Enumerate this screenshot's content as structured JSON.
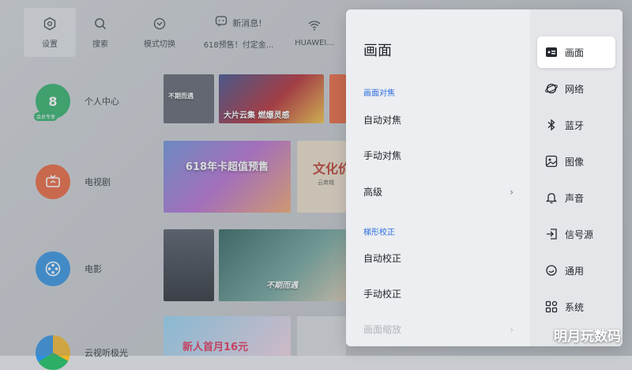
{
  "topbar": {
    "settings": "设置",
    "search": "搜索",
    "mode_switch": "模式切换",
    "message_title": "新消息!",
    "message_text": "618预售！付定金...",
    "wifi": "HUAWEI..."
  },
  "categories": {
    "personal": "个人中心",
    "personal_badge": "会员专享",
    "tv": "电视剧",
    "movie": "电影",
    "video": "云视听极光"
  },
  "tiles": {
    "t1_caption": "大片云集 燃爆灵感",
    "t1_small": "不期而遇",
    "t2_caption": "618年卡超值预售",
    "t3_caption": "文化价",
    "t3_small": "云商城",
    "t4_caption": "不期而遇",
    "t5_caption": "新人首月16元"
  },
  "panel": {
    "title": "画面",
    "section_focus": "画面对焦",
    "auto_focus": "自动对焦",
    "manual_focus": "手动对焦",
    "advanced": "高级",
    "section_keystone": "梯形校正",
    "auto_correct": "自动校正",
    "manual_correct": "手动校正",
    "picture_zoom": "画面缩放"
  },
  "nav": {
    "picture": "画面",
    "network": "网络",
    "bluetooth": "蓝牙",
    "image": "图像",
    "sound": "声音",
    "source": "信号源",
    "general": "通用",
    "system": "系统"
  },
  "watermark": "明月玩数码",
  "colors": {
    "accent": "#2d6fe0",
    "personal_icon": "#2cae66",
    "tv_icon": "#e8623a",
    "movie_icon": "#2f8fe0"
  }
}
